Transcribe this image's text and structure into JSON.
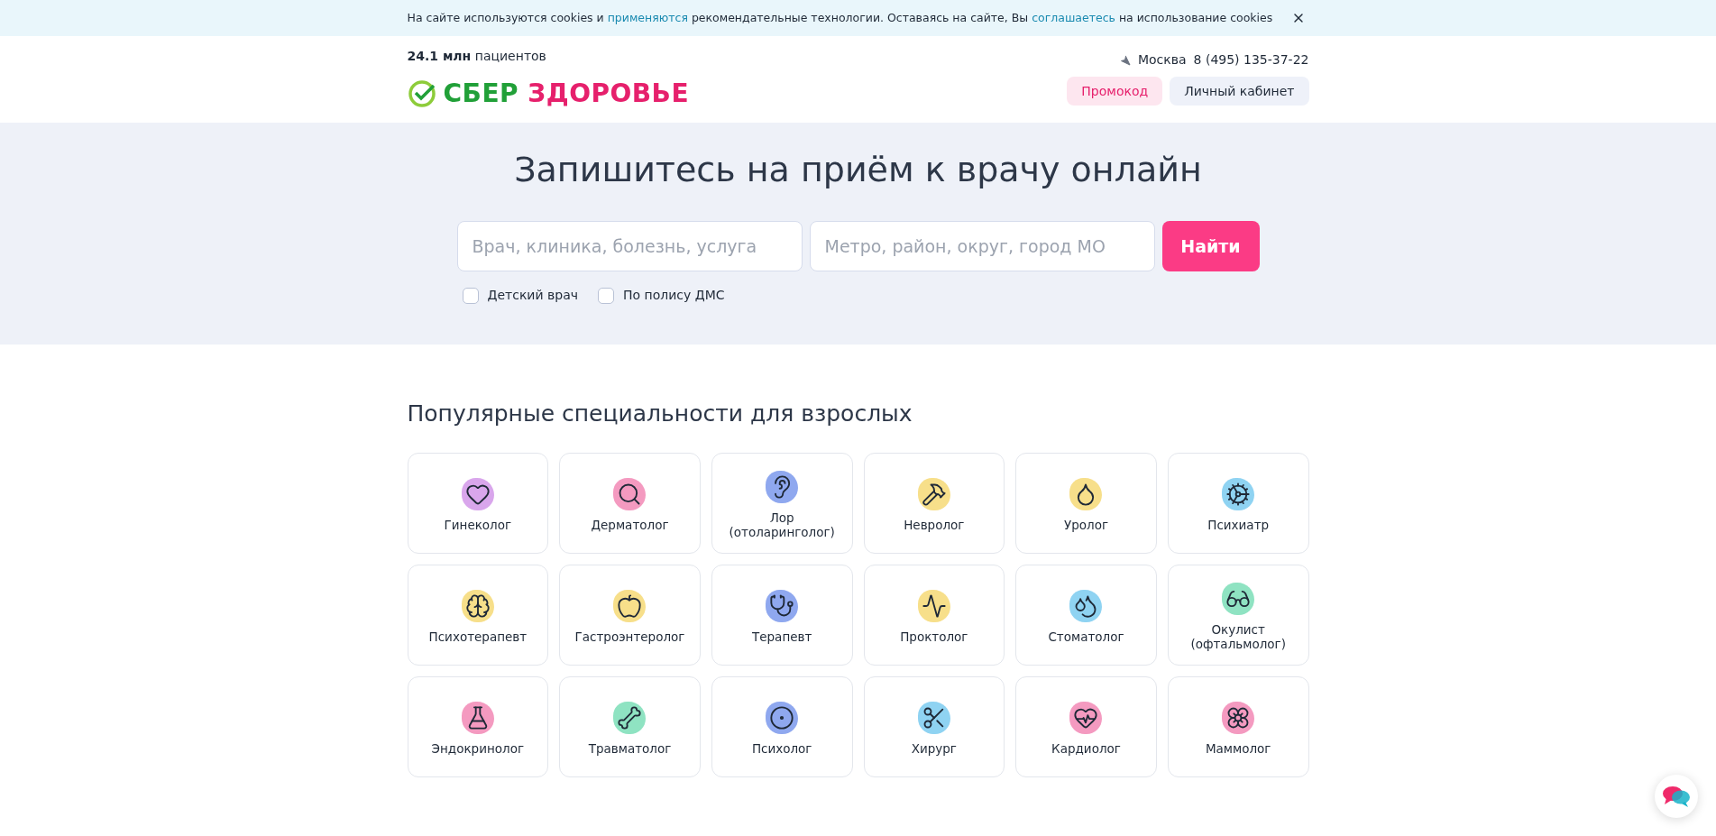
{
  "cookie_bar": {
    "text_parts": [
      "На сайте используются cookies и ",
      "применяются",
      " рекомендательные технологии. Оставаясь на сайте, Вы ",
      "соглашаетесь",
      " на использование cookies"
    ]
  },
  "header": {
    "patients_bold": "24.1 млн",
    "patients_rest": "пациентов",
    "logo_green": "СБЕР",
    "logo_pink": "ЗДОРОВЬЕ",
    "city": "Москва",
    "phone": "8 (495) 135-37-22",
    "promo_button": "Промокод",
    "account_button": "Личный кабинет"
  },
  "hero": {
    "title": "Запишитесь на приём к врачу онлайн",
    "search_placeholder": "Врач, клиника, болезнь, услуга",
    "location_placeholder": "Метро, район, округ, город МО",
    "find_button": "Найти",
    "filters": [
      {
        "label": "Детский врач",
        "checked": false
      },
      {
        "label": "По полису ДМС",
        "checked": false
      }
    ]
  },
  "specialties": {
    "title": "Популярные специальности для взрослых",
    "items": [
      {
        "label": "Гинеколог",
        "kind": "heart",
        "color": "#d9a6ec"
      },
      {
        "label": "Дерматолог",
        "kind": "magnifier",
        "color": "#f49ac0"
      },
      {
        "label": "Лор\n(отоларинголог)",
        "kind": "ear",
        "color": "#8fa8ef"
      },
      {
        "label": "Невролог",
        "kind": "hammer",
        "color": "#f7df8a"
      },
      {
        "label": "Уролог",
        "kind": "droplet",
        "color": "#f7df8a"
      },
      {
        "label": "Психиатр",
        "kind": "cog",
        "color": "#8fd3f2"
      },
      {
        "label": "Психотерапевт",
        "kind": "brain",
        "color": "#f7df8a"
      },
      {
        "label": "Гастроэнтеролог",
        "kind": "apple",
        "color": "#f7df8a"
      },
      {
        "label": "Терапевт",
        "kind": "stethoscope",
        "color": "#8fa8ef"
      },
      {
        "label": "Проктолог",
        "kind": "activity",
        "color": "#f7df8a"
      },
      {
        "label": "Стоматолог",
        "kind": "droplets",
        "color": "#8fd3f2"
      },
      {
        "label": "Окулист\n(офтальмолог)",
        "kind": "glasses",
        "color": "#8fe3c2"
      },
      {
        "label": "Эндокринолог",
        "kind": "flask",
        "color": "#f49ac0"
      },
      {
        "label": "Травматолог",
        "kind": "bone",
        "color": "#8fe3c2"
      },
      {
        "label": "Психолог",
        "kind": "target",
        "color": "#8fa8ef"
      },
      {
        "label": "Хирург",
        "kind": "scissors",
        "color": "#8fd3f2"
      },
      {
        "label": "Кардиолог",
        "kind": "pulse",
        "color": "#f49ac0"
      },
      {
        "label": "Маммолог",
        "kind": "flower",
        "color": "#f49ac0"
      }
    ]
  }
}
